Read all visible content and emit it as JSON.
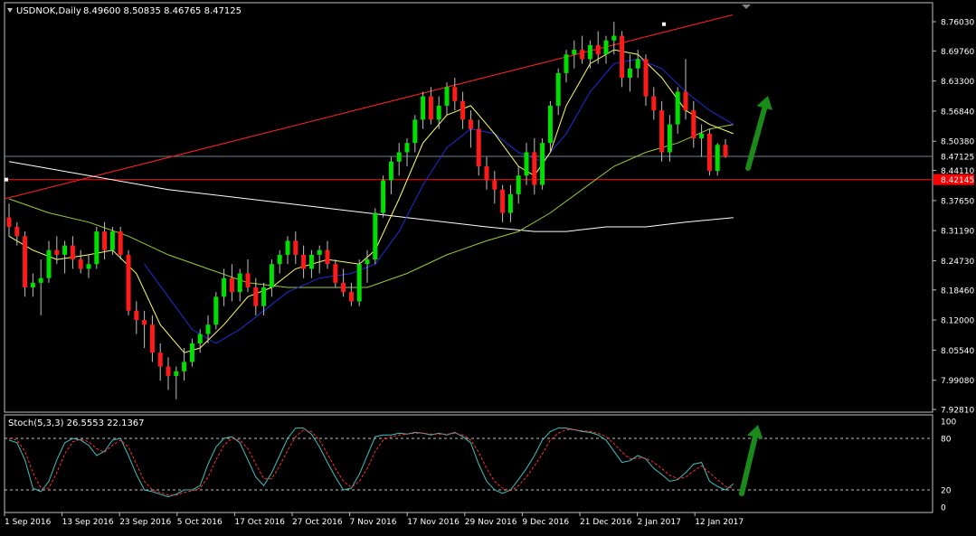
{
  "header": {
    "symbol": "USDNOK,Daily",
    "ohlc": "8.49600 8.50835 8.46765 8.47125"
  },
  "stoch_header": "Stoch(5,3,3) 26.5553 22.1367",
  "colors": {
    "background": "#000000",
    "frame": "#c0c0c0",
    "text": "#ffffff",
    "bull": "#00e000",
    "bear": "#ff1a1a",
    "wick": "#c0c0c0",
    "ma_fast": "#ffff66",
    "ma_mid": "#1f2dd6",
    "ma_slow": "#9acd32",
    "ma_long": "#ffffff",
    "trendline": "#ff2020",
    "hline": "#ff0000",
    "current_price_line": "#708090",
    "stoch_main": "#40c0c0",
    "stoch_signal": "#ff3030",
    "arrow": "#1a8a1a"
  },
  "chart_data": [
    {
      "type": "candlestick",
      "title": "USDNOK,Daily",
      "y_ticks": [
        "8.76030",
        "8.69760",
        "8.63300",
        "8.56840",
        "8.50380",
        "8.44110",
        "8.37650",
        "8.31190",
        "8.24730",
        "8.18460",
        "8.12000",
        "8.05540",
        "7.99080",
        "7.92810"
      ],
      "ylim": [
        7.9281,
        8.7603
      ],
      "current_price": "8.47125",
      "hline_price": "8.42145",
      "x_ticks": [
        "1 Sep 2016",
        "13 Sep 2016",
        "23 Sep 2016",
        "5 Oct 2016",
        "17 Oct 2016",
        "27 Oct 2016",
        "7 Nov 2016",
        "17 Nov 2016",
        "29 Nov 2016",
        "9 Dec 2016",
        "21 Dec 2016",
        "2 Jan 2017",
        "12 Jan 2017"
      ],
      "candles": [
        [
          8.34,
          8.37,
          8.3,
          8.32
        ],
        [
          8.32,
          8.33,
          8.28,
          8.3
        ],
        [
          8.3,
          8.31,
          8.17,
          8.19
        ],
        [
          8.19,
          8.22,
          8.17,
          8.2
        ],
        [
          8.2,
          8.25,
          8.13,
          8.21
        ],
        [
          8.21,
          8.29,
          8.2,
          8.27
        ],
        [
          8.27,
          8.3,
          8.24,
          8.26
        ],
        [
          8.26,
          8.29,
          8.22,
          8.28
        ],
        [
          8.28,
          8.3,
          8.23,
          8.25
        ],
        [
          8.25,
          8.27,
          8.22,
          8.23
        ],
        [
          8.23,
          8.26,
          8.21,
          8.24
        ],
        [
          8.24,
          8.32,
          8.23,
          8.31
        ],
        [
          8.31,
          8.33,
          8.25,
          8.27
        ],
        [
          8.27,
          8.32,
          8.26,
          8.31
        ],
        [
          8.31,
          8.32,
          8.25,
          8.26
        ],
        [
          8.26,
          8.27,
          8.13,
          8.14
        ],
        [
          8.14,
          8.16,
          8.09,
          8.12
        ],
        [
          8.12,
          8.14,
          8.06,
          8.11
        ],
        [
          8.11,
          8.13,
          8.03,
          8.05
        ],
        [
          8.05,
          8.07,
          7.99,
          8.02
        ],
        [
          8.02,
          8.04,
          7.97,
          8.0
        ],
        [
          8.0,
          8.02,
          7.95,
          8.01
        ],
        [
          8.01,
          8.06,
          7.99,
          8.03
        ],
        [
          8.03,
          8.08,
          8.02,
          8.07
        ],
        [
          8.07,
          8.1,
          8.05,
          8.09
        ],
        [
          8.09,
          8.13,
          8.07,
          8.11
        ],
        [
          8.11,
          8.18,
          8.1,
          8.17
        ],
        [
          8.17,
          8.23,
          8.15,
          8.21
        ],
        [
          8.21,
          8.24,
          8.16,
          8.18
        ],
        [
          8.18,
          8.23,
          8.16,
          8.22
        ],
        [
          8.22,
          8.25,
          8.18,
          8.19
        ],
        [
          8.19,
          8.21,
          8.13,
          8.15
        ],
        [
          8.15,
          8.2,
          8.13,
          8.19
        ],
        [
          8.19,
          8.25,
          8.17,
          8.24
        ],
        [
          8.24,
          8.27,
          8.22,
          8.26
        ],
        [
          8.26,
          8.3,
          8.24,
          8.29
        ],
        [
          8.29,
          8.31,
          8.24,
          8.26
        ],
        [
          8.26,
          8.28,
          8.21,
          8.23
        ],
        [
          8.23,
          8.27,
          8.21,
          8.26
        ],
        [
          8.26,
          8.28,
          8.22,
          8.27
        ],
        [
          8.27,
          8.29,
          8.23,
          8.24
        ],
        [
          8.24,
          8.25,
          8.19,
          8.2
        ],
        [
          8.2,
          8.23,
          8.17,
          8.18
        ],
        [
          8.18,
          8.2,
          8.15,
          8.16
        ],
        [
          8.16,
          8.25,
          8.15,
          8.24
        ],
        [
          8.24,
          8.27,
          8.2,
          8.25
        ],
        [
          8.25,
          8.36,
          8.24,
          8.35
        ],
        [
          8.35,
          8.43,
          8.34,
          8.42
        ],
        [
          8.42,
          8.47,
          8.39,
          8.46
        ],
        [
          8.46,
          8.5,
          8.43,
          8.48
        ],
        [
          8.48,
          8.51,
          8.45,
          8.5
        ],
        [
          8.5,
          8.56,
          8.48,
          8.55
        ],
        [
          8.55,
          8.61,
          8.53,
          8.6
        ],
        [
          8.6,
          8.62,
          8.54,
          8.55
        ],
        [
          8.55,
          8.6,
          8.53,
          8.58
        ],
        [
          8.58,
          8.63,
          8.56,
          8.62
        ],
        [
          8.62,
          8.64,
          8.57,
          8.59
        ],
        [
          8.59,
          8.61,
          8.53,
          8.55
        ],
        [
          8.55,
          8.57,
          8.49,
          8.53
        ],
        [
          8.53,
          8.55,
          8.43,
          8.45
        ],
        [
          8.45,
          8.47,
          8.4,
          8.42
        ],
        [
          8.42,
          8.44,
          8.37,
          8.4
        ],
        [
          8.4,
          8.41,
          8.33,
          8.35
        ],
        [
          8.35,
          8.41,
          8.33,
          8.39
        ],
        [
          8.39,
          8.45,
          8.37,
          8.43
        ],
        [
          8.43,
          8.5,
          8.41,
          8.48
        ],
        [
          8.48,
          8.51,
          8.39,
          8.41
        ],
        [
          8.41,
          8.51,
          8.4,
          8.5
        ],
        [
          8.5,
          8.59,
          8.48,
          8.58
        ],
        [
          8.58,
          8.66,
          8.56,
          8.65
        ],
        [
          8.65,
          8.7,
          8.63,
          8.69
        ],
        [
          8.69,
          8.72,
          8.66,
          8.7
        ],
        [
          8.7,
          8.73,
          8.67,
          8.68
        ],
        [
          8.68,
          8.72,
          8.66,
          8.71
        ],
        [
          8.71,
          8.74,
          8.67,
          8.69
        ],
        [
          8.69,
          8.73,
          8.67,
          8.72
        ],
        [
          8.72,
          8.76,
          8.69,
          8.73
        ],
        [
          8.73,
          8.74,
          8.62,
          8.64
        ],
        [
          8.64,
          8.69,
          8.61,
          8.66
        ],
        [
          8.66,
          8.7,
          8.64,
          8.68
        ],
        [
          8.68,
          8.69,
          8.58,
          8.6
        ],
        [
          8.6,
          8.62,
          8.55,
          8.57
        ],
        [
          8.57,
          8.59,
          8.46,
          8.48
        ],
        [
          8.48,
          8.56,
          8.46,
          8.54
        ],
        [
          8.54,
          8.62,
          8.52,
          8.61
        ],
        [
          8.61,
          8.68,
          8.55,
          8.57
        ],
        [
          8.57,
          8.59,
          8.49,
          8.51
        ],
        [
          8.51,
          8.54,
          8.47,
          8.52
        ],
        [
          8.52,
          8.53,
          8.43,
          8.44
        ],
        [
          8.44,
          8.5,
          8.43,
          8.496
        ],
        [
          8.496,
          8.508,
          8.468,
          8.471
        ]
      ],
      "ma_fast": [
        [
          0,
          8.3
        ],
        [
          3,
          8.27
        ],
        [
          6,
          8.25
        ],
        [
          10,
          8.26
        ],
        [
          13,
          8.27
        ],
        [
          16,
          8.22
        ],
        [
          19,
          8.11
        ],
        [
          22,
          8.05
        ],
        [
          24,
          8.06
        ],
        [
          27,
          8.11
        ],
        [
          30,
          8.17
        ],
        [
          33,
          8.19
        ],
        [
          36,
          8.23
        ],
        [
          40,
          8.25
        ],
        [
          44,
          8.24
        ],
        [
          46,
          8.27
        ],
        [
          49,
          8.38
        ],
        [
          52,
          8.5
        ],
        [
          55,
          8.56
        ],
        [
          58,
          8.58
        ],
        [
          61,
          8.52
        ],
        [
          64,
          8.45
        ],
        [
          66,
          8.43
        ],
        [
          68,
          8.48
        ],
        [
          70,
          8.58
        ],
        [
          73,
          8.67
        ],
        [
          76,
          8.7
        ],
        [
          79,
          8.69
        ],
        [
          82,
          8.64
        ],
        [
          85,
          8.57
        ],
        [
          88,
          8.54
        ],
        [
          91,
          8.52
        ]
      ],
      "ma_mid": [
        [
          17,
          8.24
        ],
        [
          20,
          8.17
        ],
        [
          23,
          8.1
        ],
        [
          26,
          8.07
        ],
        [
          29,
          8.1
        ],
        [
          32,
          8.14
        ],
        [
          35,
          8.18
        ],
        [
          39,
          8.21
        ],
        [
          43,
          8.22
        ],
        [
          46,
          8.24
        ],
        [
          49,
          8.31
        ],
        [
          52,
          8.41
        ],
        [
          55,
          8.49
        ],
        [
          58,
          8.53
        ],
        [
          61,
          8.52
        ],
        [
          64,
          8.48
        ],
        [
          67,
          8.46
        ],
        [
          70,
          8.52
        ],
        [
          73,
          8.61
        ],
        [
          76,
          8.67
        ],
        [
          79,
          8.68
        ],
        [
          82,
          8.66
        ],
        [
          85,
          8.61
        ],
        [
          88,
          8.57
        ],
        [
          91,
          8.54
        ]
      ],
      "ma_slow": [
        [
          0,
          8.38
        ],
        [
          5,
          8.35
        ],
        [
          10,
          8.33
        ],
        [
          15,
          8.3
        ],
        [
          20,
          8.26
        ],
        [
          25,
          8.23
        ],
        [
          30,
          8.2
        ],
        [
          35,
          8.19
        ],
        [
          40,
          8.19
        ],
        [
          45,
          8.19
        ],
        [
          50,
          8.22
        ],
        [
          55,
          8.26
        ],
        [
          60,
          8.29
        ],
        [
          64,
          8.31
        ],
        [
          68,
          8.35
        ],
        [
          72,
          8.4
        ],
        [
          76,
          8.45
        ],
        [
          80,
          8.48
        ],
        [
          84,
          8.5
        ],
        [
          88,
          8.53
        ],
        [
          91,
          8.54
        ]
      ],
      "ma_long": [
        [
          0,
          8.46
        ],
        [
          10,
          8.43
        ],
        [
          20,
          8.4
        ],
        [
          30,
          8.38
        ],
        [
          40,
          8.36
        ],
        [
          50,
          8.34
        ],
        [
          60,
          8.32
        ],
        [
          66,
          8.31
        ],
        [
          70,
          8.31
        ],
        [
          75,
          8.32
        ],
        [
          80,
          8.32
        ],
        [
          85,
          8.33
        ],
        [
          91,
          8.34
        ]
      ]
    },
    {
      "type": "line",
      "title": "Stoch(5,3,3) 26.5553 22.1367",
      "y_ticks": [
        "100",
        "80",
        "20",
        "0"
      ],
      "ylim": [
        0,
        100
      ],
      "levels": [
        80,
        20
      ],
      "series": [
        {
          "name": "",
          "values": [
            78,
            75,
            55,
            22,
            18,
            30,
            55,
            75,
            80,
            78,
            72,
            60,
            65,
            78,
            80,
            60,
            38,
            20,
            18,
            15,
            12,
            15,
            20,
            20,
            25,
            50,
            70,
            80,
            82,
            75,
            55,
            35,
            25,
            40,
            60,
            80,
            92,
            92,
            85,
            70,
            52,
            35,
            20,
            22,
            38,
            60,
            82,
            84,
            84,
            86,
            85,
            87,
            86,
            84,
            86,
            84,
            87,
            82,
            75,
            50,
            30,
            20,
            16,
            20,
            32,
            45,
            60,
            78,
            88,
            92,
            92,
            90,
            88,
            87,
            84,
            78,
            65,
            52,
            54,
            60,
            56,
            45,
            38,
            30,
            32,
            40,
            50,
            52,
            30,
            24,
            20,
            27
          ]
        },
        {
          "name": "",
          "values": [
            80,
            78,
            65,
            40,
            22,
            22,
            40,
            62,
            76,
            79,
            76,
            68,
            64,
            72,
            78,
            70,
            50,
            30,
            20,
            17,
            14,
            14,
            17,
            19,
            22,
            35,
            55,
            72,
            80,
            78,
            68,
            50,
            33,
            33,
            48,
            66,
            82,
            90,
            88,
            78,
            62,
            45,
            30,
            23,
            30,
            45,
            65,
            78,
            82,
            84,
            85,
            86,
            86,
            85,
            85,
            85,
            86,
            84,
            78,
            64,
            45,
            30,
            22,
            19,
            25,
            35,
            48,
            62,
            78,
            86,
            90,
            90,
            89,
            88,
            86,
            82,
            74,
            64,
            56,
            57,
            57,
            52,
            45,
            37,
            33,
            35,
            42,
            48,
            40,
            32,
            24,
            22
          ]
        }
      ]
    }
  ]
}
